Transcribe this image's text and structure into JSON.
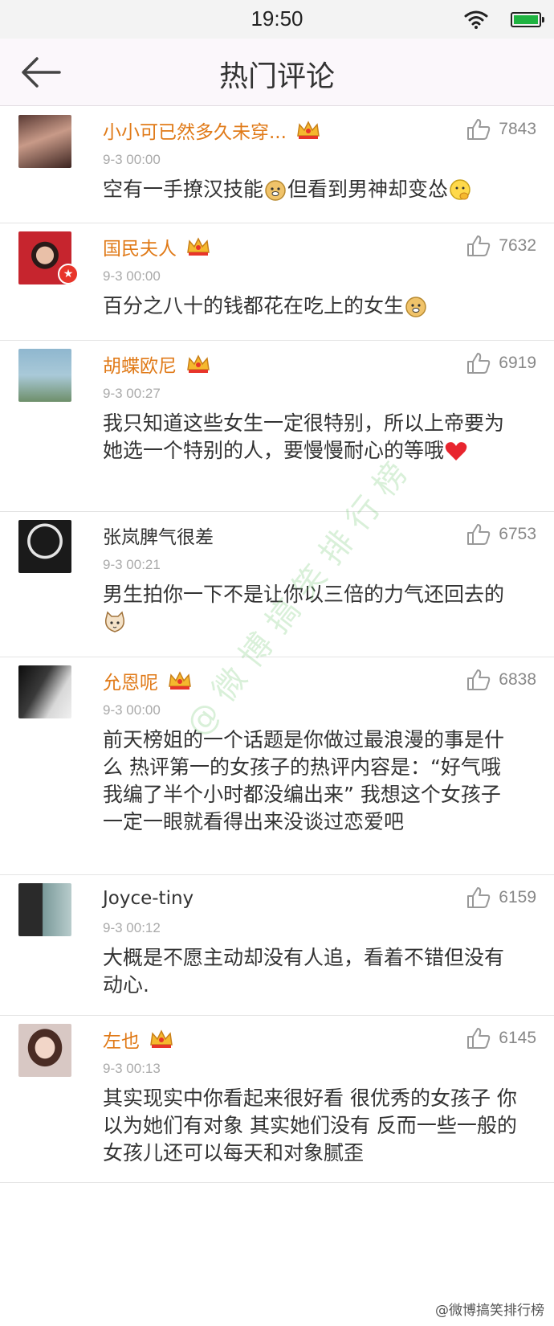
{
  "status_bar": {
    "time": "19:50"
  },
  "header": {
    "title": "热门评论"
  },
  "comments": [
    {
      "username": "小小可已然多久未穿...",
      "timestamp": "9-3 00:00",
      "likes": "7843",
      "text": "空有一手撩汉技能",
      "text_after": "但看到男神却变怂"
    },
    {
      "username": "国民夫人",
      "timestamp": "9-3 00:00",
      "likes": "7632",
      "text": "百分之八十的钱都花在吃上的女生"
    },
    {
      "username": "胡蝶欧尼",
      "timestamp": "9-3 00:27",
      "likes": "6919",
      "text": "我只知道这些女生一定很特别，所以上帝要为她选一个特别的人，要慢慢耐心的等哦"
    },
    {
      "username": "张岚脾气很差",
      "timestamp": "9-3 00:21",
      "likes": "6753",
      "text": "男生拍你一下不是让你以三倍的力气还回去的"
    },
    {
      "username": "允恩呢",
      "timestamp": "9-3 00:00",
      "likes": "6838",
      "text": "前天榜姐的一个话题是你做过最浪漫的事是什么 热评第一的女孩子的热评内容是：“好气哦 我编了半个小时都没编出来” 我想这个女孩子一定一眼就看得出来没谈过恋爱吧"
    },
    {
      "username": "Joyce-tiny",
      "timestamp": "9-3 00:12",
      "likes": "6159",
      "text": "大概是不愿主动却没有人追，看着不错但没有动心."
    },
    {
      "username": "左也",
      "timestamp": "9-3 00:13",
      "likes": "6145",
      "text": "其实现实中你看起来很好看 很优秀的女孩子  你以为她们有对象  其实她们没有  反而一些一般的女孩儿还可以每天和对象腻歪"
    }
  ],
  "watermark": {
    "text": "@微博搞笑排行榜",
    "corner": "@微博搞笑排行榜"
  },
  "colors": {
    "vip_name": "#e07a18",
    "status_bar": "#f3f3f3",
    "nav_bar": "#fbf7fb",
    "battery": "#1fb341"
  }
}
